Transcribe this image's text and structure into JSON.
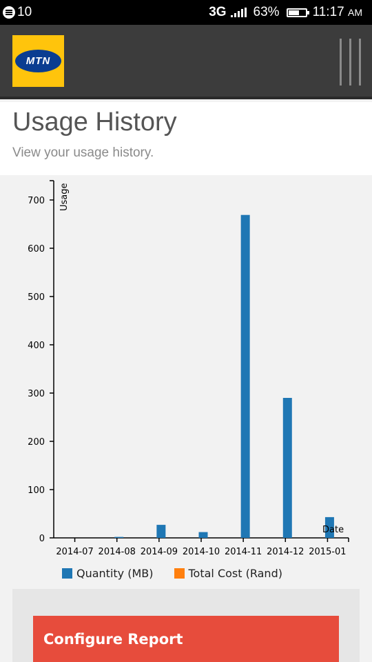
{
  "status_bar": {
    "notification_count": "10",
    "network": "3G",
    "battery_percent": "63%",
    "battery_level": 0.63,
    "time": "11:17",
    "ampm": "AM"
  },
  "header": {
    "logo_text": "MTN",
    "colors": {
      "background": "#3c3c3c",
      "logo_yellow": "#ffc40c",
      "logo_blue": "#0a3d91"
    }
  },
  "page": {
    "title": "Usage History",
    "subtitle": "View your usage history."
  },
  "chart_data": {
    "type": "bar",
    "categories": [
      "2014-07",
      "2014-08",
      "2014-09",
      "2014-10",
      "2014-11",
      "2014-12",
      "2015-01"
    ],
    "series": [
      {
        "name": "Quantity (MB)",
        "color": "#1f77b4",
        "values": [
          0,
          2,
          27,
          12,
          669,
          290,
          43
        ]
      },
      {
        "name": "Total Cost (Rand)",
        "color": "#ff7f0e",
        "values": [
          0,
          0,
          0,
          0,
          0,
          0,
          0
        ]
      }
    ],
    "ylabel": "Usage",
    "xlabel": "Date",
    "ylim": [
      0,
      740
    ],
    "yticks": [
      0,
      100,
      200,
      300,
      400,
      500,
      600,
      700
    ],
    "grid": false,
    "legend_position": "bottom"
  },
  "config": {
    "button_label": "Configure Report",
    "button_color": "#e74c3c"
  }
}
